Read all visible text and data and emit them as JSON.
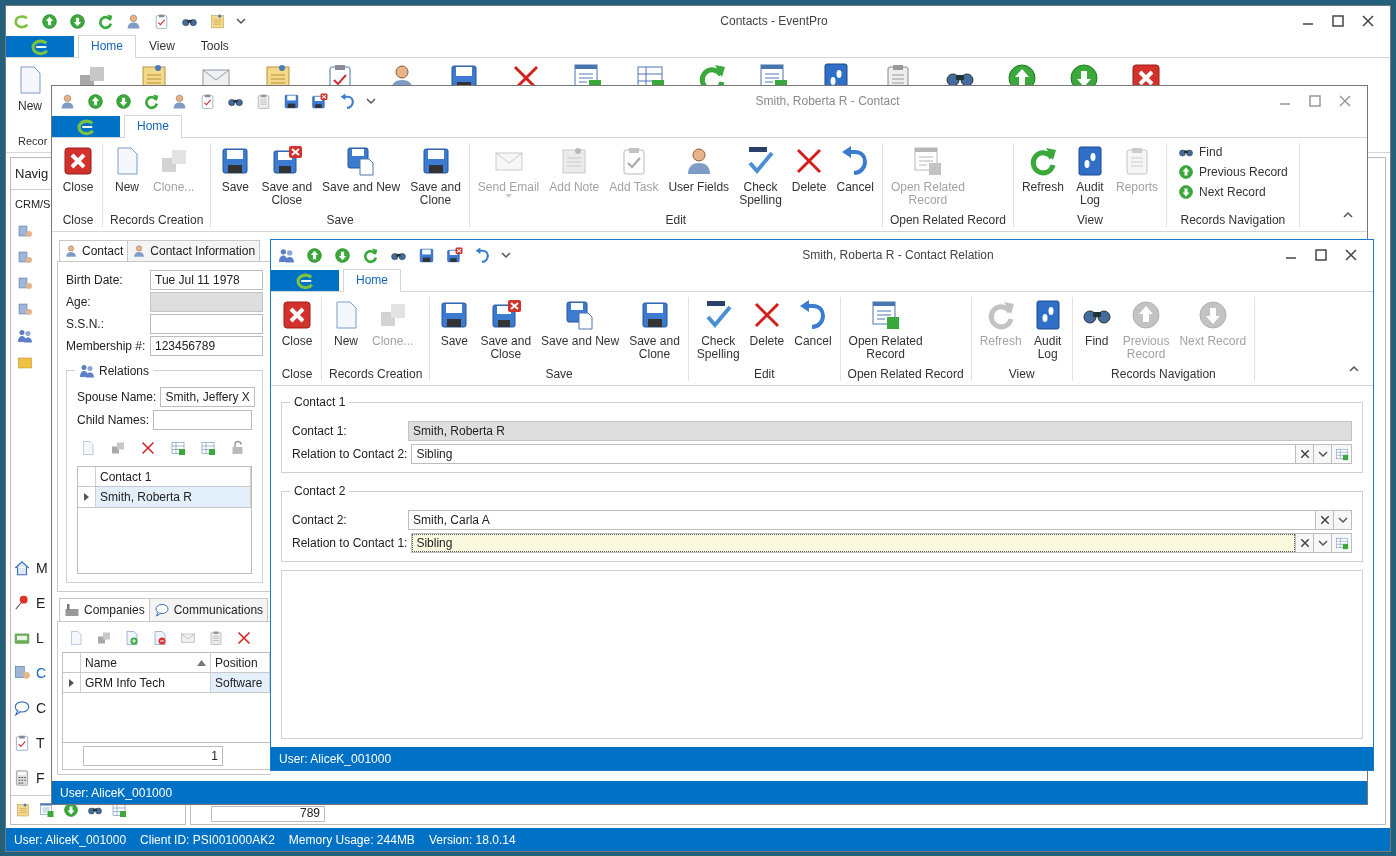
{
  "main_window": {
    "title": "Contacts - EventPro",
    "tabs": [
      {
        "label": "Home",
        "selected": true
      },
      {
        "label": "View",
        "selected": false
      },
      {
        "label": "Tools",
        "selected": false
      }
    ],
    "ribbon": {
      "button": "New",
      "group": "Recor"
    },
    "navigation": {
      "header": "Navig",
      "section": "CRM/S",
      "items": [
        {
          "label": "M",
          "selected": false
        },
        {
          "label": "E",
          "selected": false
        },
        {
          "label": "L",
          "selected": false
        },
        {
          "label": "C",
          "selected": true
        },
        {
          "label": "C",
          "selected": false
        },
        {
          "label": "T",
          "selected": false
        },
        {
          "label": "F",
          "selected": false
        }
      ]
    },
    "pager": "789",
    "status_bar": [
      "User: AliceK_001000",
      "Client ID: PSI001000AK2",
      "Memory Usage: 244MB",
      "Version: 18.0.14"
    ]
  },
  "contact_window": {
    "title": "Smith, Roberta R - Contact",
    "tabs": [
      {
        "label": "Home",
        "selected": true
      }
    ],
    "ribbon": [
      {
        "label": "Close",
        "kind": "large",
        "buttons": [
          {
            "label": "Close",
            "kind": "close",
            "disabled": false
          }
        ]
      },
      {
        "label": "Records Creation",
        "kind": "large",
        "buttons": [
          {
            "label": "New",
            "kind": "new",
            "disabled": false
          },
          {
            "label": "Clone...",
            "kind": "clone",
            "disabled": true
          }
        ]
      },
      {
        "label": "Save",
        "kind": "large",
        "buttons": [
          {
            "label": "Save",
            "kind": "save",
            "disabled": false
          },
          {
            "label": "Save and\nClose",
            "kind": "saveclose",
            "disabled": false
          },
          {
            "label": "Save and New",
            "kind": "savenew",
            "disabled": false
          },
          {
            "label": "Save and\nClone",
            "kind": "save",
            "disabled": false
          }
        ]
      },
      {
        "label": "Edit",
        "kind": "large",
        "buttons": [
          {
            "label": "Send Email",
            "kind": "mail",
            "disabled": true,
            "dropdown": true
          },
          {
            "label": "Add Note",
            "kind": "note",
            "disabled": true
          },
          {
            "label": "Add Task",
            "kind": "task",
            "disabled": true
          },
          {
            "label": "User Fields",
            "kind": "user",
            "disabled": false
          },
          {
            "label": "Check\nSpelling",
            "kind": "spell",
            "disabled": false
          },
          {
            "label": "Delete",
            "kind": "delete",
            "disabled": false
          },
          {
            "label": "Cancel",
            "kind": "undo",
            "disabled": false
          }
        ]
      },
      {
        "label": "Open Related Record",
        "kind": "large",
        "buttons": [
          {
            "label": "Open Related\nRecord",
            "kind": "openrel",
            "disabled": true
          }
        ]
      },
      {
        "label": "View",
        "kind": "large",
        "buttons": [
          {
            "label": "Refresh",
            "kind": "refresh",
            "disabled": false
          },
          {
            "label": "Audit\nLog",
            "kind": "audit",
            "disabled": false
          },
          {
            "label": "Reports",
            "kind": "reports",
            "disabled": true
          }
        ]
      },
      {
        "label": "Records Navigation",
        "kind": "small",
        "buttons": [
          {
            "label": "Find",
            "kind": "find",
            "disabled": false
          },
          {
            "label": "Previous Record",
            "kind": "up",
            "disabled": false
          },
          {
            "label": "Next Record",
            "kind": "down",
            "disabled": false
          }
        ]
      }
    ],
    "form_tabs": [
      {
        "label": "Contact",
        "selected": true
      },
      {
        "label": "Contact Information",
        "selected": false
      }
    ],
    "fields": [
      {
        "label": "Birth Date:",
        "value": "Tue Jul 11 1978",
        "disabled": false
      },
      {
        "label": "Age:",
        "disabled": true
      },
      {
        "label": "S.S.N.:",
        "disabled": false
      },
      {
        "label": "Membership #:",
        "value": "123456789",
        "disabled": false
      }
    ],
    "relations": {
      "title": "Relations",
      "fields": [
        {
          "label": "Spouse Name:",
          "value": "Smith, Jeffery X"
        },
        {
          "label": "Child Names:"
        }
      ],
      "grid": {
        "columns": [
          "Contact 1"
        ],
        "rows": [
          {
            "cells": [
              "Smith, Roberta R"
            ],
            "selected": true
          }
        ]
      }
    },
    "bottom_tabs": [
      {
        "label": "Companies",
        "selected": true
      },
      {
        "label": "Communications",
        "selected": false
      }
    ],
    "companies_grid": {
      "columns": [
        {
          "label": "Name",
          "sorted": true
        },
        {
          "label": "Position",
          "sorted": false
        }
      ],
      "rows": [
        {
          "cells": [
            {
              "text": "GRM Info Tech",
              "selected": false
            },
            {
              "text": "Software",
              "selected": true
            }
          ]
        }
      ]
    },
    "pager": "1",
    "status_bar": "User: AliceK_001000"
  },
  "relation_window": {
    "title": "Smith, Roberta R - Contact Relation",
    "tabs": [
      {
        "label": "Home",
        "selected": true
      }
    ],
    "ribbon": [
      {
        "label": "Close",
        "kind": "large",
        "buttons": [
          {
            "label": "Close",
            "kind": "close",
            "disabled": false
          }
        ]
      },
      {
        "label": "Records Creation",
        "kind": "large",
        "buttons": [
          {
            "label": "New",
            "kind": "new",
            "disabled": false
          },
          {
            "label": "Clone...",
            "kind": "clone",
            "disabled": true
          }
        ]
      },
      {
        "label": "Save",
        "kind": "large",
        "buttons": [
          {
            "label": "Save",
            "kind": "save",
            "disabled": false
          },
          {
            "label": "Save and\nClose",
            "kind": "saveclose",
            "disabled": false
          },
          {
            "label": "Save and New",
            "kind": "savenew",
            "disabled": false
          },
          {
            "label": "Save and\nClone",
            "kind": "save",
            "disabled": false
          }
        ]
      },
      {
        "label": "Edit",
        "kind": "large",
        "buttons": [
          {
            "label": "Check\nSpelling",
            "kind": "spell",
            "disabled": false
          },
          {
            "label": "Delete",
            "kind": "delete",
            "disabled": false
          },
          {
            "label": "Cancel",
            "kind": "undo",
            "disabled": false
          }
        ]
      },
      {
        "label": "Open Related Record",
        "kind": "large",
        "buttons": [
          {
            "label": "Open Related\nRecord",
            "kind": "openrel",
            "disabled": false
          }
        ]
      },
      {
        "label": "View",
        "kind": "large",
        "buttons": [
          {
            "label": "Refresh",
            "kind": "refresh",
            "disabled": true
          },
          {
            "label": "Audit\nLog",
            "kind": "audit",
            "disabled": false
          }
        ]
      },
      {
        "label": "Records Navigation",
        "kind": "large",
        "buttons": [
          {
            "label": "Find",
            "kind": "find",
            "disabled": false
          },
          {
            "label": "Previous\nRecord",
            "kind": "up",
            "disabled": true
          },
          {
            "label": "Next Record",
            "kind": "down",
            "disabled": true
          }
        ]
      }
    ],
    "groups": [
      {
        "title": "Contact 1",
        "fields": [
          {
            "label": "Contact 1:",
            "value": "Smith, Roberta R",
            "kind": "readonly",
            "focused": false
          },
          {
            "label": "Relation to Contact 2:",
            "value": "Sibling",
            "kind": "lookup",
            "focused": false
          }
        ]
      },
      {
        "title": "Contact 2",
        "fields": [
          {
            "label": "Contact 2:",
            "value": "Smith, Carla A",
            "kind": "combo",
            "focused": false
          },
          {
            "label": "Relation to Contact 1:",
            "value": "Sibling",
            "kind": "lookup",
            "focused": true
          }
        ]
      }
    ],
    "status_bar": "User: AliceK_001000"
  }
}
